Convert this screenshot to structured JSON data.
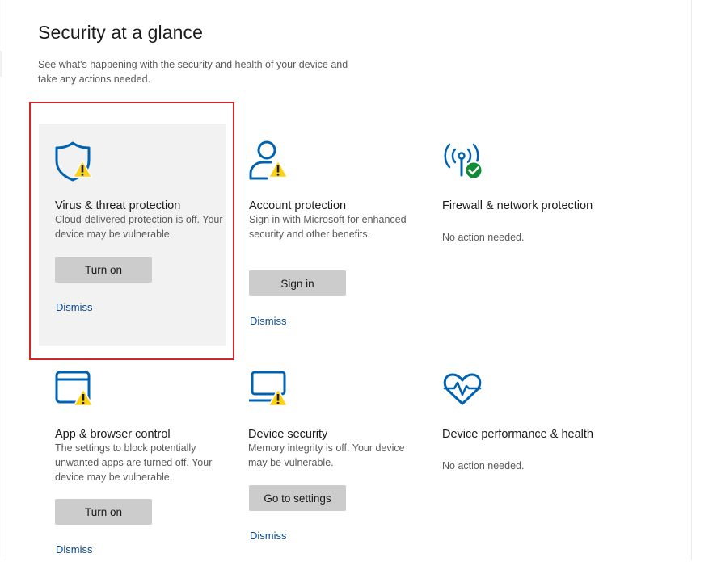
{
  "page": {
    "title": "Security at a glance",
    "subtitle": "See what's happening with the security and health of your device and take any actions needed."
  },
  "cards": [
    {
      "title": "Virus & threat protection",
      "description": "Cloud-delivered protection is off. Your device may be vulnerable.",
      "button_label": "Turn on",
      "dismiss_label": "Dismiss",
      "icon": "shield-warning-icon"
    },
    {
      "title": "Account protection",
      "description": "Sign in with Microsoft for enhanced security and other benefits.",
      "button_label": "Sign in",
      "dismiss_label": "Dismiss",
      "icon": "account-warning-icon"
    },
    {
      "title": "Firewall & network protection",
      "description": "No action needed.",
      "icon": "wifi-antenna-check-icon"
    },
    {
      "title": "App & browser control",
      "description": "The settings to block potentially unwanted apps are turned off. Your device may be vulnerable.",
      "button_label": "Turn on",
      "dismiss_label": "Dismiss",
      "icon": "browser-window-warning-icon"
    },
    {
      "title": "Device security",
      "description": "Memory integrity is off. Your device may be vulnerable.",
      "button_label": "Go to settings",
      "dismiss_label": "Dismiss",
      "icon": "laptop-warning-icon"
    },
    {
      "title": "Device performance & health",
      "description": "No action needed.",
      "icon": "heart-pulse-icon"
    }
  ],
  "colors": {
    "icon_blue": "#0063b1",
    "warning_yellow": "#fcd116",
    "ok_green": "#108c34",
    "link_blue": "#0b4a8e",
    "button_gray": "#cccccc",
    "highlight_red": "#d0262b",
    "card_hover_bg": "#f2f2f2"
  }
}
